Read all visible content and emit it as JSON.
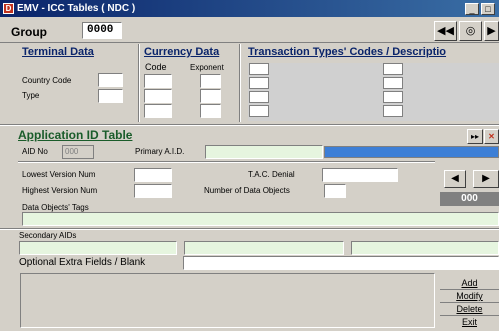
{
  "window": {
    "title": "EMV - ICC Tables ( NDC )",
    "icon_glyph": "D",
    "min_glyph": "_",
    "max_glyph": "□"
  },
  "group": {
    "label": "Group",
    "value": "0000"
  },
  "nav": {
    "prev_glyph": "◀◀",
    "search_glyph": "◎",
    "next_glyph": "▶"
  },
  "terminal": {
    "heading": "Terminal Data",
    "country_code_label": "Country Code",
    "type_label": "Type"
  },
  "currency": {
    "heading": "Currency Data",
    "code_label": "Code",
    "exponent_label": "Exponent"
  },
  "transaction": {
    "heading": "Transaction Types' Codes / Descriptio"
  },
  "aid": {
    "heading": "Application ID Table",
    "aid_no_label": "AID No",
    "aid_no_value": "000",
    "primary_aid_label": "Primary A.I.D.",
    "small_btn_1": "▸▸",
    "small_btn_2": "✕",
    "lowest_version_label": "Lowest Version Num",
    "highest_version_label": "Highest Version Num",
    "tac_denial_label": "T.A.C. Denial",
    "num_data_objects_label": "Number of Data Objects",
    "data_objects_tags_label": "Data Objects' Tags",
    "counter_value": "000",
    "left_arrow": "◀",
    "right_arrow": "▶"
  },
  "secondary": {
    "label": "Secondary AIDs"
  },
  "optional": {
    "label": "Optional Extra Fields / Blank"
  },
  "actions": {
    "add": "Add",
    "modify": "Modify",
    "delete": "Delete",
    "exit": "Exit"
  }
}
